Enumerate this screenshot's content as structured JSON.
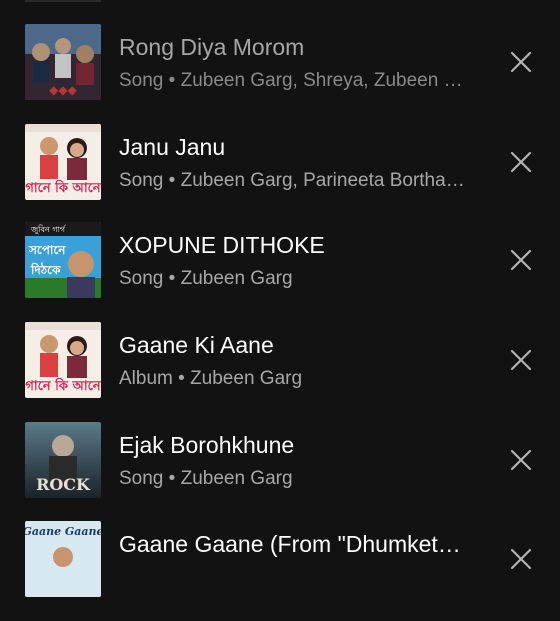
{
  "results": [
    {
      "title": "Rong Diya Morom",
      "type": "Song",
      "artists": "Zubeen Garg, Shreya, Zubeen …",
      "thumb_icon": "album-art-rong-diya-morom",
      "close_icon": "close-icon"
    },
    {
      "title": "Janu Janu",
      "type": "Song",
      "artists": "Zubeen Garg, Parineeta Bortha…",
      "thumb_icon": "album-art-gaane-ki-aane",
      "close_icon": "close-icon"
    },
    {
      "title": "XOPUNE DITHOKE",
      "type": "Song",
      "artists": "Zubeen Garg",
      "thumb_icon": "album-art-xopune-dithoke",
      "close_icon": "close-icon"
    },
    {
      "title": "Gaane Ki Aane",
      "type": "Album",
      "artists": "Zubeen Garg",
      "thumb_icon": "album-art-gaane-ki-aane",
      "close_icon": "close-icon"
    },
    {
      "title": "Ejak Borohkhune",
      "type": "Song",
      "artists": "Zubeen Garg",
      "thumb_icon": "album-art-rock",
      "close_icon": "close-icon"
    },
    {
      "title": "Gaane Gaane (From \"Dhumket…",
      "type": "",
      "artists": "",
      "thumb_icon": "album-art-gaane-gaane",
      "close_icon": "close-icon"
    }
  ],
  "subtitles": [
    "Song • Zubeen Garg, Shreya, Zubeen …",
    "Song • Zubeen Garg, Parineeta Bortha…",
    "Song • Zubeen Garg",
    "Album • Zubeen Garg",
    "Song • Zubeen Garg",
    ""
  ],
  "art_text": {
    "gaane_ki_aane": "গানে কি আনে",
    "xopune_top": "জুবিন গাৰ্গ",
    "xopune_main1": "সপোনে",
    "xopune_main2": "দিঠকে",
    "rock": "ROCK",
    "gaane_gaane": "Gaane Gaane"
  },
  "colors": {
    "background": "#121212",
    "title": "#ffffff",
    "subtitle": "#a7a7a7"
  }
}
